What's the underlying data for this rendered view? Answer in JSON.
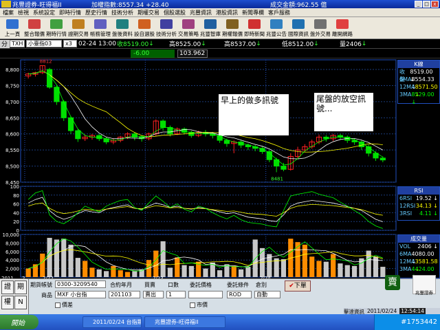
{
  "title_bar": {
    "app_title": "兆豐證券-旺得福II",
    "index_text": "加權指數:8557.34 +28.40",
    "volume_text": "成交金額:962.55  億",
    "controls": [
      "_",
      "□",
      "x"
    ]
  },
  "menu": [
    "檔案",
    "檢視",
    "系統設定",
    "即時行情",
    "歷史行情",
    "技術分析",
    "期權交易",
    "個股選股",
    "兆豐資訊",
    "港股資訊",
    "新聞專欄",
    "客戶服務"
  ],
  "toolbar": [
    "上一頁",
    "整合報價",
    "期時行情",
    "證期交易",
    "帳務管理",
    "盤後資料",
    "設自選股",
    "技術分析",
    "交易策略",
    "兆豐智庫",
    "期權報價",
    "即時新聞",
    "兆豐公告",
    "國際資訊",
    "盤外交易",
    "離開網路"
  ],
  "quote": {
    "market_tab": "分",
    "code": "TXH",
    "name": "小臺指03",
    "multiplier": "x3",
    "datetime": "02-24 13:00",
    "close_label": "收8519.00",
    "close_arrow": "↓",
    "high_label": "高8525.00",
    "high_arrow": "↓",
    "open_label": "高8537.00",
    "open_arrow": "↓",
    "low_label": "低8512.00",
    "low_arrow": "↓",
    "volume_label": "量2406",
    "volume_arrow": "↓",
    "change": "-6.00",
    "spread": "103.962"
  },
  "chart_data": [
    {
      "type": "candlestick",
      "title": "K線",
      "ylim": [
        8450,
        8830
      ],
      "yticks": [
        "8,800",
        "8,750",
        "8,700",
        "8,650",
        "8,600",
        "8,550",
        "8,500",
        "8,450"
      ],
      "annotations": [
        "8812",
        "8481"
      ],
      "legend": [
        {
          "name": "收盤",
          "value": "8519.00 ↓",
          "color": "#ffffff"
        },
        {
          "name": "6MA",
          "value": "8554.33 ↓",
          "color": "#ffffff"
        },
        {
          "name": "12MA",
          "value": "8571.50 ↓",
          "color": "#ffff00"
        },
        {
          "name": "3MA",
          "value": "8529.00 ↓",
          "color": "#00ff00"
        }
      ],
      "candles": [
        [
          8780,
          8786,
          8772,
          8790
        ],
        [
          8785,
          8790,
          8778,
          8793
        ],
        [
          8790,
          8812,
          8786,
          8812
        ],
        [
          8800,
          8745,
          8740,
          8805
        ],
        [
          8745,
          8700,
          8690,
          8750
        ],
        [
          8700,
          8650,
          8640,
          8705
        ],
        [
          8650,
          8610,
          8600,
          8655
        ],
        [
          8610,
          8585,
          8575,
          8615
        ],
        [
          8585,
          8590,
          8578,
          8598
        ],
        [
          8590,
          8595,
          8582,
          8600
        ],
        [
          8595,
          8585,
          8578,
          8600
        ],
        [
          8585,
          8575,
          8568,
          8590
        ],
        [
          8575,
          8580,
          8568,
          8586
        ],
        [
          8580,
          8590,
          8574,
          8594
        ],
        [
          8590,
          8600,
          8584,
          8605
        ],
        [
          8600,
          8590,
          8580,
          8606
        ],
        [
          8590,
          8585,
          8576,
          8596
        ],
        [
          8585,
          8600,
          8580,
          8604
        ],
        [
          8600,
          8640,
          8594,
          8645
        ],
        [
          8640,
          8620,
          8610,
          8645
        ],
        [
          8620,
          8600,
          8592,
          8626
        ],
        [
          8600,
          8615,
          8596,
          8620
        ],
        [
          8615,
          8605,
          8598,
          8620
        ],
        [
          8605,
          8595,
          8588,
          8610
        ],
        [
          8595,
          8605,
          8590,
          8610
        ],
        [
          8605,
          8600,
          8592,
          8612
        ],
        [
          8600,
          8595,
          8586,
          8606
        ],
        [
          8595,
          8580,
          8572,
          8600
        ],
        [
          8580,
          8570,
          8560,
          8585
        ],
        [
          8570,
          8575,
          8540,
          8580
        ],
        [
          8575,
          8565,
          8556,
          8580
        ],
        [
          8565,
          8560,
          8550,
          8570
        ],
        [
          8560,
          8555,
          8546,
          8566
        ],
        [
          8555,
          8545,
          8538,
          8560
        ],
        [
          8545,
          8520,
          8512,
          8550
        ],
        [
          8520,
          8500,
          8481,
          8526
        ],
        [
          8500,
          8490,
          8484,
          8510
        ],
        [
          8490,
          8530,
          8486,
          8540
        ],
        [
          8530,
          8550,
          8524,
          8560
        ],
        [
          8550,
          8560,
          8544,
          8568
        ],
        [
          8560,
          8575,
          8554,
          8582
        ],
        [
          8575,
          8590,
          8568,
          8598
        ],
        [
          8590,
          8585,
          8576,
          8596
        ],
        [
          8585,
          8595,
          8578,
          8600
        ],
        [
          8595,
          8590,
          8582,
          8600
        ],
        [
          8590,
          8580,
          8572,
          8595
        ],
        [
          8580,
          8575,
          8566,
          8586
        ],
        [
          8575,
          8560,
          8550,
          8580
        ],
        [
          8560,
          8540,
          8530,
          8566
        ],
        [
          8540,
          8525,
          8516,
          8546
        ],
        [
          8525,
          8519,
          8512,
          8530
        ]
      ]
    },
    {
      "type": "line",
      "title": "RSI",
      "ylim": [
        0,
        100
      ],
      "yticks": [
        "100",
        "80",
        "60",
        "40",
        "20",
        "0"
      ],
      "legend": [
        {
          "name": "6RSI",
          "value": "19.52 ↓",
          "color": "#ffffff"
        },
        {
          "name": "12RSI",
          "value": "34.13 ↓",
          "color": "#ffff00"
        },
        {
          "name": "3RSI",
          "value": "4.11 ↓",
          "color": "#00ff00"
        }
      ],
      "series": [
        {
          "name": "6RSI",
          "values": [
            62,
            70,
            75,
            45,
            32,
            25,
            30,
            38,
            45,
            42,
            40,
            48,
            52,
            55,
            58,
            50,
            48,
            55,
            62,
            58,
            52,
            55,
            50,
            48,
            52,
            50,
            46,
            42,
            38,
            40,
            35,
            30,
            28,
            26,
            22,
            20,
            35,
            55,
            62,
            65,
            68,
            66,
            64,
            62,
            58,
            54,
            50,
            45,
            35,
            25,
            19.52
          ]
        },
        {
          "name": "12RSI",
          "values": [
            55,
            60,
            62,
            50,
            42,
            38,
            40,
            44,
            48,
            46,
            45,
            48,
            50,
            52,
            54,
            50,
            49,
            52,
            56,
            54,
            51,
            52,
            50,
            49,
            50,
            49,
            47,
            45,
            43,
            44,
            41,
            38,
            37,
            36,
            34,
            32,
            40,
            50,
            55,
            57,
            59,
            58,
            57,
            56,
            54,
            52,
            50,
            47,
            42,
            37,
            34.13
          ]
        },
        {
          "name": "3RSI",
          "values": [
            70,
            85,
            90,
            35,
            20,
            15,
            25,
            40,
            55,
            48,
            42,
            55,
            62,
            68,
            70,
            52,
            45,
            62,
            78,
            66,
            52,
            60,
            48,
            42,
            55,
            50,
            40,
            32,
            26,
            34,
            24,
            18,
            16,
            14,
            10,
            8,
            45,
            78,
            82,
            85,
            88,
            82,
            78,
            74,
            64,
            55,
            45,
            35,
            20,
            10,
            4.11
          ]
        }
      ]
    },
    {
      "type": "bar",
      "title": "成交量",
      "ylim": [
        0,
        10000
      ],
      "yticks": [
        "10,000",
        "8,000",
        "6,000",
        "4,000",
        "2,000"
      ],
      "legend": [
        {
          "name": "VOL",
          "value": "2406 ↓",
          "color": "#ffffff"
        },
        {
          "name": "6MA",
          "value": "4080.00 ↓",
          "color": "#ffffff"
        },
        {
          "name": "12MA",
          "value": "3581.58 ↓",
          "color": "#ffff00"
        },
        {
          "name": "3MA",
          "value": "4424.00 ↓",
          "color": "#00ff00"
        }
      ],
      "values": [
        2000,
        3000,
        5500,
        9200,
        8800,
        9000,
        7600,
        4500,
        3800,
        2200,
        1800,
        1400,
        2600,
        1600,
        1200,
        1400,
        1800,
        4000,
        6200,
        8400,
        2200,
        4600,
        2800,
        2600,
        3600,
        2000,
        3400,
        1600,
        3000,
        2600,
        1800,
        2400,
        8800,
        6800,
        5400,
        4400,
        4200,
        9000,
        8200,
        7600,
        4800,
        3800,
        3600,
        5400,
        3200,
        2800,
        2600,
        4400,
        6200,
        4800,
        2406
      ]
    }
  ],
  "x_axis": [
    "2011",
    "2",
    "2/22",
    "2/23",
    "2/24"
  ],
  "annotations": {
    "morning": "早上的做多訊號",
    "closing": "尾盤的放空訊號..."
  },
  "order": {
    "side_buttons": [
      "證",
      "期",
      "權",
      "N"
    ],
    "account_label": "期貨帳號",
    "account_value": "0300-3209540",
    "product_label": "商品",
    "product_value": "MXF 小台指",
    "contract_label": "合約年月",
    "contract_value": "201103",
    "buysell_label": "買賣",
    "buysell_value": "賣出",
    "qty_label": "口數",
    "qty_value": "1",
    "price_label": "委託價格",
    "price_value": "",
    "cond_label": "委託條件",
    "cond_value": "ROD",
    "offset_label": "倉別",
    "offset_value": "自動",
    "spread_check": "價差",
    "market_check": "市價",
    "submit": "下單",
    "sell_icon": "賣",
    "brand": "兆豐證券",
    "status_left": "擊達資訊",
    "status_date": "2011/02/24",
    "status_time": "12:54:14"
  },
  "taskbar": {
    "start": "開始",
    "items": [
      "2011/02/24 台指期盤",
      "兆豐證券-旺得福II"
    ],
    "watermark": "#1753442"
  },
  "colors": {
    "up": "#ff2020",
    "down": "#00e000",
    "ma6": "#ffffff",
    "ma12": "#ffff00",
    "ma3": "#00ff00",
    "vol_up": "#ff8c00",
    "vol_down": "#c8c8c8"
  }
}
